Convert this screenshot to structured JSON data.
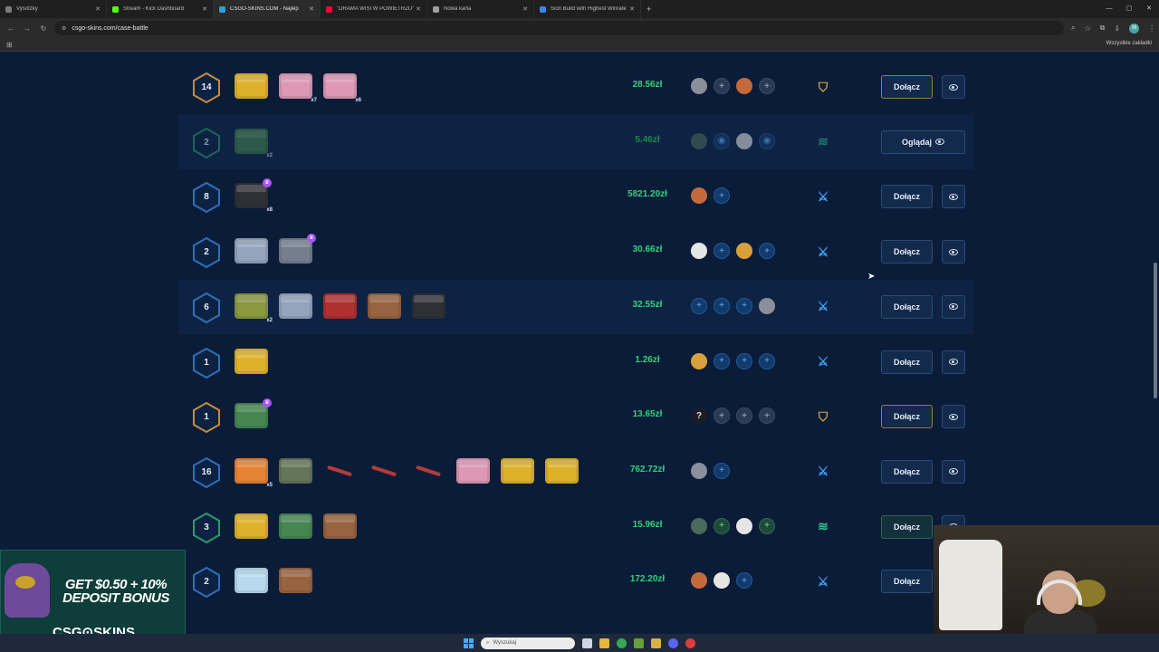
{
  "browser": {
    "tabs": [
      {
        "title": "Vysotzky",
        "color": "#7c7c7c",
        "active": false
      },
      {
        "title": "Stream - Kick Dashboard",
        "color": "#53fc18",
        "active": false
      },
      {
        "title": "CSGO-SKINS.COM - Najlep",
        "color": "#2fa0d8",
        "active": true
      },
      {
        "title": "\"DRAMA WISI W POWIETRZU\"",
        "color": "#ff0033",
        "active": false
      },
      {
        "title": "Nowa karta",
        "color": "#9aa0a6",
        "active": false
      },
      {
        "title": "Sion Build with Highest Winrate",
        "color": "#3b82f6",
        "active": false
      }
    ],
    "url": "csgo-skins.com/case-battle",
    "avatar_letter": "M",
    "bookmarks_label": "Wszystkie zakładki"
  },
  "battles": [
    {
      "rounds": "14",
      "ring": "gold",
      "cases": [
        {
          "c": "c-gold"
        },
        {
          "c": "c-pink",
          "mult": "x7"
        },
        {
          "c": "c-pink",
          "mult": "x6"
        }
      ],
      "price": "28.56zł",
      "players": [
        "av",
        "add",
        "av",
        "add"
      ],
      "mode": "shield",
      "action": "Dołącz",
      "btn": "gold"
    },
    {
      "rounds": "2",
      "ring": "green",
      "dim": true,
      "cases": [
        {
          "c": "c-green",
          "mult": "x2"
        }
      ],
      "price": "5.46zł",
      "players": [
        "av",
        "blue",
        "av",
        "blue"
      ],
      "mode": "hands",
      "action": "Oglądaj",
      "watch": true
    },
    {
      "rounds": "8",
      "ring": "blue",
      "cases": [
        {
          "c": "c-dark",
          "mult": "x8",
          "star": true
        }
      ],
      "price": "5821.20zł",
      "players": [
        "av",
        "blue"
      ],
      "mode": "swords",
      "action": "Dołącz"
    },
    {
      "rounds": "2",
      "ring": "blue",
      "cases": [
        {
          "c": "c-steel"
        },
        {
          "c": "c-grey",
          "star": true
        }
      ],
      "price": "30.66zł",
      "players": [
        "av",
        "blue",
        "av",
        "blue"
      ],
      "mode": "swords",
      "action": "Dołącz"
    },
    {
      "rounds": "6",
      "ring": "blue",
      "alt": true,
      "cases": [
        {
          "c": "c-olive",
          "mult": "x2"
        },
        {
          "c": "c-steel"
        },
        {
          "c": "c-red"
        },
        {
          "c": "c-brown"
        },
        {
          "c": "c-dark"
        }
      ],
      "price": "32.55zł",
      "players": [
        "blue",
        "blue",
        "blue",
        "av"
      ],
      "mode": "swords",
      "action": "Dołącz"
    },
    {
      "rounds": "1",
      "ring": "blue",
      "cases": [
        {
          "c": "c-gold"
        }
      ],
      "price": "1.26zł",
      "players": [
        "av",
        "blue",
        "blue",
        "blue"
      ],
      "mode": "swords",
      "action": "Dołącz"
    },
    {
      "rounds": "1",
      "ring": "gold",
      "cases": [
        {
          "c": "c-green",
          "star": true
        }
      ],
      "price": "13.65zł",
      "players": [
        "q",
        "add",
        "add",
        "add"
      ],
      "mode": "shield",
      "action": "Dołącz",
      "btn": "gold"
    },
    {
      "rounds": "16",
      "ring": "blue",
      "cases": [
        {
          "c": "c-orange",
          "mult": "x5"
        },
        {
          "c": "c-camo"
        },
        {
          "c": "c-knife"
        },
        {
          "c": "c-knife"
        },
        {
          "c": "c-knife"
        },
        {
          "c": "c-pink"
        },
        {
          "c": "c-gold"
        },
        {
          "c": "c-gold"
        }
      ],
      "price": "762.72zł",
      "players": [
        "av",
        "blue"
      ],
      "mode": "swords",
      "action": "Dołącz"
    },
    {
      "rounds": "3",
      "ring": "green",
      "cases": [
        {
          "c": "c-gold"
        },
        {
          "c": "c-green"
        },
        {
          "c": "c-brown"
        }
      ],
      "price": "15.96zł",
      "players": [
        "av",
        "green",
        "av",
        "green"
      ],
      "mode": "hands",
      "action": "Dołącz",
      "btn": "green"
    },
    {
      "rounds": "2",
      "ring": "blue",
      "cases": [
        {
          "c": "c-ice"
        },
        {
          "c": "c-brown"
        }
      ],
      "price": "172.20zł",
      "players": [
        "av",
        "av",
        "blue"
      ],
      "mode": "swords",
      "action": "Dołącz"
    }
  ],
  "ad": {
    "promo": "GET $0.50 + 10% DEPOSIT BONUS",
    "brand": "CSG⊙SKINS"
  },
  "taskbar": {
    "search_placeholder": "Wyszukaj"
  }
}
